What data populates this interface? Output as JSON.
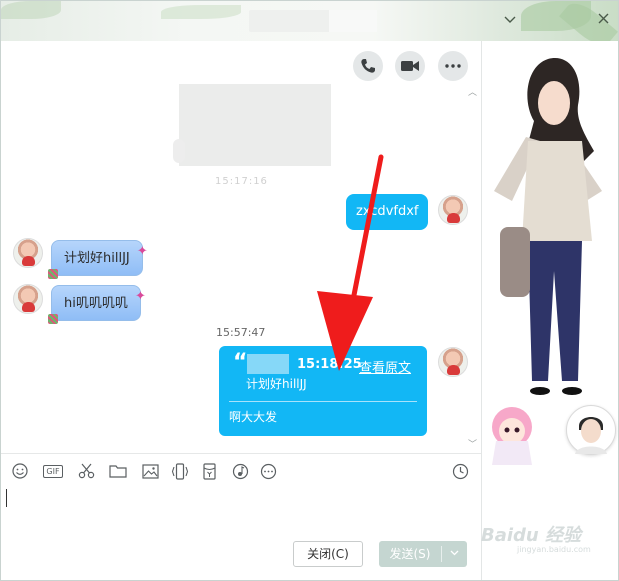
{
  "window": {
    "minimize_icon": "chevron-down-icon",
    "close_icon": "close-icon"
  },
  "header_actions": {
    "phone_icon": "phone-icon",
    "video_icon": "video-camera-icon",
    "more_icon": "more-dots-icon"
  },
  "messages": {
    "faint_timestamp": "15:17:16",
    "msg1_text": "zxcdvfdxf",
    "msg2_text": "计划好hillJJ",
    "msg3_text": "hi叽叽叽叽",
    "timestamp2": "15:57:47",
    "quote": {
      "time": "15:18:25",
      "view_original": "查看原文",
      "source_text": "计划好hillJJ",
      "reply_text": "啊大大发"
    }
  },
  "toolbar": {
    "gif_label": "GIF",
    "icons": [
      "smiley-icon",
      "gif-icon",
      "scissors-icon",
      "folder-icon",
      "image-icon",
      "shake-icon",
      "red-packet-icon",
      "music-icon",
      "more-icon",
      "history-clock-icon"
    ]
  },
  "input": {
    "close_button_label": "关闭(C)",
    "send_button_label": "发送(S)"
  },
  "watermark": {
    "brand": "Baidu 经验",
    "sub": "jingyan.baidu.com"
  },
  "colors": {
    "bubble_blue": "#12b7f5",
    "annotation_red": "#ef1c1c",
    "send_button": "#c5d6d1"
  }
}
